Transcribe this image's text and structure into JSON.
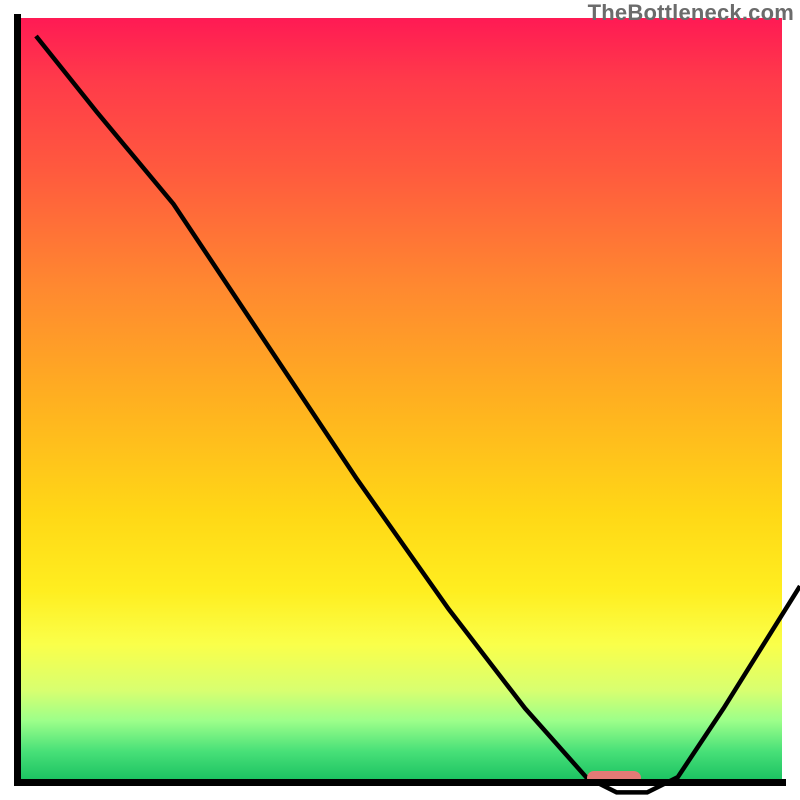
{
  "watermark": "TheBottleneck.com",
  "colors": {
    "line": "#000000",
    "marker": "#e47a76"
  },
  "chart_data": {
    "type": "line",
    "title": "",
    "xlabel": "",
    "ylabel": "",
    "xlim": [
      0,
      100
    ],
    "ylim": [
      0,
      100
    ],
    "grid": false,
    "legend": false,
    "series": [
      {
        "name": "curve",
        "x": [
          0,
          8,
          18,
          30,
          42,
          54,
          64,
          72,
          76,
          80,
          84,
          90,
          100
        ],
        "y": [
          100,
          90,
          78,
          60,
          42,
          25,
          12,
          3,
          1,
          1,
          3,
          12,
          28
        ]
      }
    ],
    "marker": {
      "x": 78,
      "y": 0.5,
      "width_pct": 7
    }
  }
}
